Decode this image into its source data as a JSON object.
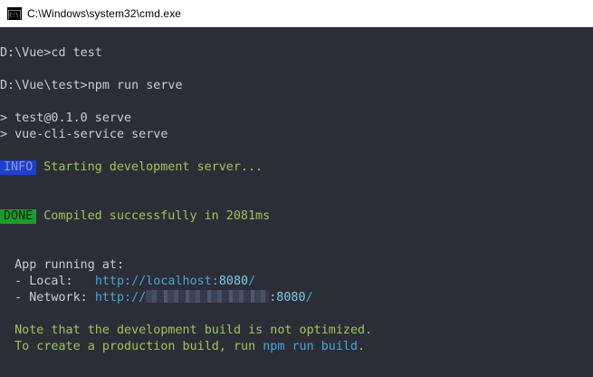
{
  "window": {
    "title": "C:\\Windows\\system32\\cmd.exe",
    "icon": "cmd-icon"
  },
  "console": {
    "cmd1": "D:\\Vue>cd test",
    "cmd2": "D:\\Vue\\test>npm run serve",
    "script1": "> test@0.1.0 serve",
    "script2": "> vue-cli-service serve",
    "info_badge": "INFO",
    "info_text": "Starting development server...",
    "done_badge": "DONE",
    "done_text": "Compiled successfully in 2081ms",
    "app_running": "  App running at:",
    "local_label": "  - Local:   ",
    "local_url": "http://localhost:",
    "local_port": "8080",
    "local_slash": "/",
    "network_label": "  - Network: ",
    "network_url": "http://",
    "network_port": ":8080",
    "network_slash": "/",
    "note1": "  Note that the development build is not optimized.",
    "note2_prefix": "  To create a production build, run ",
    "note2_cmd": "npm run build",
    "note2_suffix": "."
  },
  "colors": {
    "console_bg": "#2b2e36",
    "text": "#c8ccd2",
    "info_badge_bg": "#1f3fd1",
    "done_badge_bg": "#1e9a2d",
    "success_text": "#9ec45d",
    "url": "#47a4dc"
  }
}
